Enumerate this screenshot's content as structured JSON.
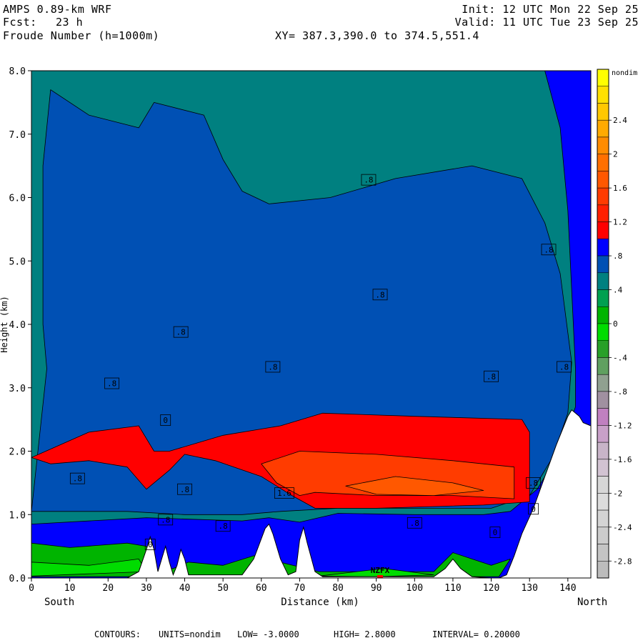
{
  "header": {
    "model": "AMPS 0.89-km WRF",
    "fcst_label": "Fcst:",
    "fcst_value": "23 h",
    "field": "Froude Number (h=1000m)",
    "init": "Init: 12 UTC Mon 22 Sep 25",
    "valid": "Valid: 11 UTC Tue 23 Sep 25",
    "xy": "XY= 387.3,390.0 to 374.5,551.4"
  },
  "footer": {
    "contours_label": "CONTOURS:",
    "units": "UNITS=nondim",
    "low": "LOW= -3.0000",
    "high": "HIGH= 2.8000",
    "interval": "INTERVAL= 0.20000"
  },
  "chart_data": {
    "type": "contour",
    "xlabel": "Distance (km)",
    "ylabel": "Height (km)",
    "x_left_label": "South",
    "x_right_label": "North",
    "xlim": [
      0,
      146
    ],
    "ylim": [
      0,
      8
    ],
    "x_ticks": [
      0,
      10,
      20,
      30,
      40,
      50,
      60,
      70,
      80,
      90,
      100,
      110,
      120,
      130,
      140
    ],
    "y_ticks": [
      "0.0",
      "1.0",
      "2.0",
      "3.0",
      "4.0",
      "5.0",
      "6.0",
      "7.0",
      "8.0"
    ],
    "station_label": "NZFX",
    "station_x": 91,
    "colorbar": {
      "unit": "nondim",
      "tick_labels": [
        "2.4",
        "2",
        "1.6",
        "1.2",
        ".8",
        ".4",
        "0",
        "-.4",
        "-.8",
        "-1.2",
        "-1.6",
        "-2",
        "-2.4",
        "-2.8"
      ],
      "tick_values": [
        2.4,
        2.0,
        1.6,
        1.2,
        0.8,
        0.4,
        0,
        -0.4,
        -0.8,
        -1.2,
        -1.6,
        -2.0,
        -2.4,
        -2.8
      ],
      "value_range": [
        -3.0,
        3.0
      ],
      "bands": [
        {
          "from": 2.8,
          "to": 3.0,
          "color": "#ffff00"
        },
        {
          "from": 2.6,
          "to": 2.8,
          "color": "#ffe000"
        },
        {
          "from": 2.4,
          "to": 2.6,
          "color": "#ffc800"
        },
        {
          "from": 2.2,
          "to": 2.4,
          "color": "#ffaa00"
        },
        {
          "from": 2.0,
          "to": 2.2,
          "color": "#ff8c00"
        },
        {
          "from": 1.8,
          "to": 2.0,
          "color": "#ff7000"
        },
        {
          "from": 1.6,
          "to": 1.8,
          "color": "#ff5800"
        },
        {
          "from": 1.4,
          "to": 1.6,
          "color": "#ff3c00"
        },
        {
          "from": 1.2,
          "to": 1.4,
          "color": "#ff2000"
        },
        {
          "from": 1.0,
          "to": 1.2,
          "color": "#ff0000"
        },
        {
          "from": 0.8,
          "to": 1.0,
          "color": "#0000ff"
        },
        {
          "from": 0.6,
          "to": 0.8,
          "color": "#0050b4"
        },
        {
          "from": 0.4,
          "to": 0.6,
          "color": "#008080"
        },
        {
          "from": 0.2,
          "to": 0.4,
          "color": "#00a050"
        },
        {
          "from": 0.0,
          "to": 0.2,
          "color": "#00b400"
        },
        {
          "from": -0.2,
          "to": 0.0,
          "color": "#00dc00"
        },
        {
          "from": -0.4,
          "to": -0.2,
          "color": "#28a028"
        },
        {
          "from": -0.6,
          "to": -0.4,
          "color": "#60a060"
        },
        {
          "from": -0.8,
          "to": -0.6,
          "color": "#90a090"
        },
        {
          "from": -1.0,
          "to": -0.8,
          "color": "#a090a0"
        },
        {
          "from": -1.2,
          "to": -1.0,
          "color": "#c080c0"
        },
        {
          "from": -1.4,
          "to": -1.2,
          "color": "#c8a0c8"
        },
        {
          "from": -1.6,
          "to": -1.4,
          "color": "#c8b4c8"
        },
        {
          "from": -1.8,
          "to": -1.6,
          "color": "#d2c3d2"
        },
        {
          "from": -2.0,
          "to": -1.8,
          "color": "#d7d7d7"
        },
        {
          "from": -2.2,
          "to": -2.0,
          "color": "#dcdcdc"
        },
        {
          "from": -2.4,
          "to": -2.2,
          "color": "#d4d4d4"
        },
        {
          "from": -2.6,
          "to": -2.4,
          "color": "#cccccc"
        },
        {
          "from": -2.8,
          "to": -2.6,
          "color": "#c4c4c4"
        },
        {
          "from": -3.0,
          "to": -2.8,
          "color": "#bcbcbc"
        }
      ]
    },
    "terrain_km": [
      [
        0,
        0
      ],
      [
        25,
        0
      ],
      [
        28,
        0.1
      ],
      [
        30,
        0.45
      ],
      [
        31,
        0.65
      ],
      [
        32,
        0.45
      ],
      [
        33,
        0.1
      ],
      [
        34,
        0.3
      ],
      [
        35,
        0.5
      ],
      [
        36,
        0.25
      ],
      [
        37,
        0.05
      ],
      [
        38,
        0.2
      ],
      [
        39,
        0.45
      ],
      [
        40,
        0.3
      ],
      [
        41,
        0.05
      ],
      [
        55,
        0.05
      ],
      [
        58,
        0.3
      ],
      [
        61,
        0.78
      ],
      [
        62,
        0.85
      ],
      [
        63,
        0.7
      ],
      [
        65,
        0.3
      ],
      [
        67,
        0.05
      ],
      [
        69,
        0.1
      ],
      [
        70,
        0.6
      ],
      [
        71,
        0.8
      ],
      [
        72,
        0.55
      ],
      [
        74,
        0.1
      ],
      [
        76,
        0.02
      ],
      [
        105,
        0.02
      ],
      [
        108,
        0.15
      ],
      [
        110,
        0.3
      ],
      [
        112,
        0.15
      ],
      [
        115,
        0.02
      ],
      [
        120,
        0
      ],
      [
        122,
        0
      ],
      [
        124,
        0.05
      ],
      [
        126,
        0.35
      ],
      [
        128,
        0.7
      ],
      [
        131,
        1.1
      ],
      [
        134,
        1.6
      ],
      [
        137,
        2.1
      ],
      [
        140,
        2.55
      ],
      [
        141,
        2.65
      ],
      [
        143,
        2.55
      ],
      [
        144,
        2.45
      ],
      [
        146,
        2.4
      ]
    ],
    "series": [
      {
        "value": 0.7,
        "color": "#008080",
        "points": [
          [
            0,
            0.85
          ],
          [
            30,
            0.95
          ],
          [
            55,
            0.9
          ],
          [
            62,
            0.95
          ],
          [
            70,
            0.88
          ],
          [
            80,
            1.02
          ],
          [
            100,
            1.0
          ],
          [
            118,
            1.0
          ],
          [
            125,
            1.05
          ],
          [
            132,
            1.4
          ],
          [
            138,
            2.0
          ],
          [
            142,
            2.7
          ],
          [
            142,
            3.3
          ],
          [
            140,
            5.8
          ],
          [
            138,
            7.1
          ],
          [
            134,
            8
          ],
          [
            0,
            8
          ]
        ]
      },
      {
        "value": 0.9,
        "color": "#0050b4",
        "points": [
          [
            0,
            1.05
          ],
          [
            25,
            1.05
          ],
          [
            40,
            1.0
          ],
          [
            55,
            1.0
          ],
          [
            65,
            1.05
          ],
          [
            80,
            1.1
          ],
          [
            100,
            1.1
          ],
          [
            120,
            1.1
          ],
          [
            130,
            1.3
          ],
          [
            136,
            1.9
          ],
          [
            140,
            2.6
          ],
          [
            141,
            3.4
          ],
          [
            138,
            4.8
          ],
          [
            134,
            5.6
          ],
          [
            128,
            6.3
          ],
          [
            115,
            6.5
          ],
          [
            95,
            6.3
          ],
          [
            78,
            6.0
          ],
          [
            62,
            5.9
          ],
          [
            55,
            6.1
          ],
          [
            50,
            6.6
          ],
          [
            45,
            7.3
          ],
          [
            32,
            7.5
          ],
          [
            28,
            7.1
          ],
          [
            15,
            7.3
          ],
          [
            5,
            7.7
          ],
          [
            3,
            6.5
          ],
          [
            3,
            4.0
          ],
          [
            4,
            3.3
          ]
        ]
      },
      {
        "value": 1.1,
        "color": "#ff0000",
        "points": [
          [
            0,
            1.9
          ],
          [
            15,
            2.3
          ],
          [
            28,
            2.4
          ],
          [
            32,
            2.0
          ],
          [
            36,
            2.0
          ],
          [
            50,
            2.25
          ],
          [
            65,
            2.4
          ],
          [
            76,
            2.6
          ],
          [
            100,
            2.55
          ],
          [
            128,
            2.5
          ],
          [
            130,
            2.3
          ],
          [
            130,
            1.2
          ],
          [
            118,
            1.15
          ],
          [
            90,
            1.1
          ],
          [
            74,
            1.1
          ],
          [
            68,
            1.3
          ],
          [
            60,
            1.6
          ],
          [
            48,
            1.85
          ],
          [
            40,
            1.95
          ],
          [
            36,
            1.7
          ],
          [
            30,
            1.4
          ],
          [
            25,
            1.75
          ],
          [
            15,
            1.85
          ],
          [
            5,
            1.8
          ]
        ]
      },
      {
        "value": 1.4,
        "color": "#ff3c00",
        "points": [
          [
            60,
            1.8
          ],
          [
            70,
            2.0
          ],
          [
            90,
            1.95
          ],
          [
            110,
            1.85
          ],
          [
            126,
            1.75
          ],
          [
            126,
            1.25
          ],
          [
            110,
            1.3
          ],
          [
            90,
            1.3
          ],
          [
            74,
            1.35
          ],
          [
            70,
            1.3
          ],
          [
            64,
            1.5
          ]
        ]
      },
      {
        "value": 1.6,
        "color": "#ff5800",
        "points": [
          [
            82,
            1.45
          ],
          [
            95,
            1.6
          ],
          [
            110,
            1.5
          ],
          [
            118,
            1.38
          ],
          [
            105,
            1.3
          ],
          [
            90,
            1.32
          ]
        ]
      },
      {
        "value": 0.1,
        "color": "#00b400",
        "points": [
          [
            0,
            0.05
          ],
          [
            0,
            0.55
          ],
          [
            10,
            0.48
          ],
          [
            25,
            0.55
          ],
          [
            30,
            0.5
          ],
          [
            33,
            0.1
          ],
          [
            37,
            0.15
          ],
          [
            41,
            0.25
          ],
          [
            50,
            0.2
          ],
          [
            58,
            0.35
          ],
          [
            75,
            0.1
          ],
          [
            90,
            0.1
          ],
          [
            105,
            0.1
          ],
          [
            110,
            0.4
          ],
          [
            115,
            0.3
          ],
          [
            120,
            0.2
          ],
          [
            125,
            0.3
          ],
          [
            122,
            0.02
          ],
          [
            0,
            0.02
          ]
        ]
      },
      {
        "value": -0.1,
        "color": "#00dc00",
        "points": [
          [
            0,
            0.03
          ],
          [
            0,
            0.25
          ],
          [
            15,
            0.2
          ],
          [
            28,
            0.3
          ],
          [
            30,
            0.1
          ],
          [
            0,
            0.03
          ]
        ]
      },
      {
        "value": -0.1,
        "color": "#00dc00",
        "points": [
          [
            75,
            0.03
          ],
          [
            92,
            0.15
          ],
          [
            105,
            0.05
          ],
          [
            90,
            0.02
          ]
        ]
      }
    ],
    "labels": [
      {
        "text": ".8",
        "x": 21,
        "y": 3.07
      },
      {
        "text": ".8",
        "x": 12,
        "y": 1.57
      },
      {
        "text": ".8",
        "x": 39,
        "y": 3.88
      },
      {
        "text": ".8",
        "x": 63,
        "y": 3.33
      },
      {
        "text": ".8",
        "x": 88,
        "y": 6.28
      },
      {
        "text": ".8",
        "x": 91,
        "y": 4.47
      },
      {
        "text": ".8",
        "x": 120,
        "y": 3.18
      },
      {
        "text": ".8",
        "x": 135,
        "y": 5.18
      },
      {
        "text": ".8",
        "x": 139,
        "y": 3.33
      },
      {
        "text": ".8",
        "x": 40,
        "y": 1.4
      },
      {
        "text": ".8",
        "x": 35,
        "y": 0.92
      },
      {
        "text": ".8",
        "x": 50,
        "y": 0.82
      },
      {
        "text": ".8",
        "x": 100,
        "y": 0.87
      },
      {
        "text": ".8",
        "x": 131,
        "y": 1.5
      },
      {
        "text": "1.6",
        "x": 66,
        "y": 1.34
      },
      {
        "text": "0",
        "x": 35,
        "y": 2.49
      },
      {
        "text": "0",
        "x": 31,
        "y": 0.53
      },
      {
        "text": "0",
        "x": 121,
        "y": 0.72
      },
      {
        "text": "0",
        "x": 131,
        "y": 1.09
      }
    ]
  }
}
